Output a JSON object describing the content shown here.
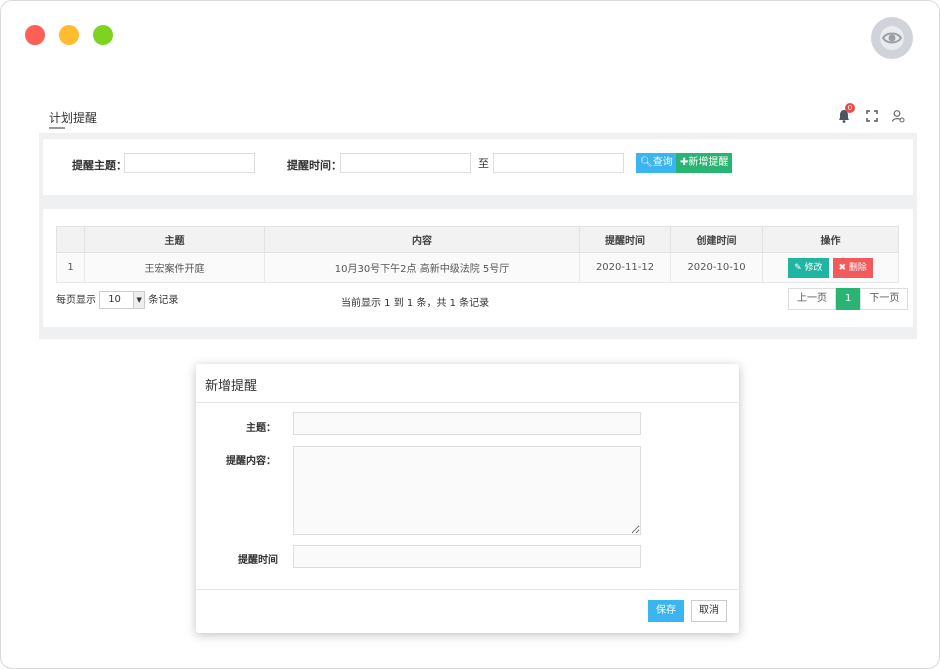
{
  "app": {
    "page_title": "计划提醒",
    "notification_count": "0",
    "icons": {
      "bell": "bell-icon",
      "fullscreen": "fullscreen-icon",
      "user": "user-settings-icon",
      "eye": "eye-icon"
    }
  },
  "search": {
    "subject_label": "提醒主题：",
    "subject_value": "",
    "time_label": "提醒时间：",
    "time_from": "",
    "to_label": "至",
    "time_to": "",
    "query_button": "查询",
    "add_button": "新增提醒"
  },
  "table": {
    "columns": [
      "",
      "主题",
      "内容",
      "提醒时间",
      "创建时间",
      "操作"
    ],
    "rows": [
      {
        "index": "1",
        "subject": "王宏案件开庭",
        "content": "10月30号下午2点 高新中级法院 5号厅",
        "remind_time": "2020-11-12",
        "created_time": "2020-10-10"
      }
    ],
    "edit_label": "修改",
    "delete_label": "删除"
  },
  "pagination": {
    "per_page_prefix": "每页显示",
    "per_page_value": "10",
    "per_page_suffix": "条记录",
    "info": "当前显示 1 到 1 条，共 1 条记录",
    "prev": "上一页",
    "current": "1",
    "next": "下一页"
  },
  "modal": {
    "title": "新增提醒",
    "subject_label": "主题：",
    "content_label": "提醒内容：",
    "time_label": "提醒时间",
    "subject_value": "",
    "content_value": "",
    "time_value": "",
    "save_button": "保存",
    "cancel_button": "取消"
  },
  "colors": {
    "close": "#fe5f57",
    "minimize": "#febc2e",
    "maximize": "#7ed321",
    "primary": "#3bb4f2",
    "success": "#29b473",
    "teal": "#1fb5a0",
    "danger": "#f25b5b"
  }
}
